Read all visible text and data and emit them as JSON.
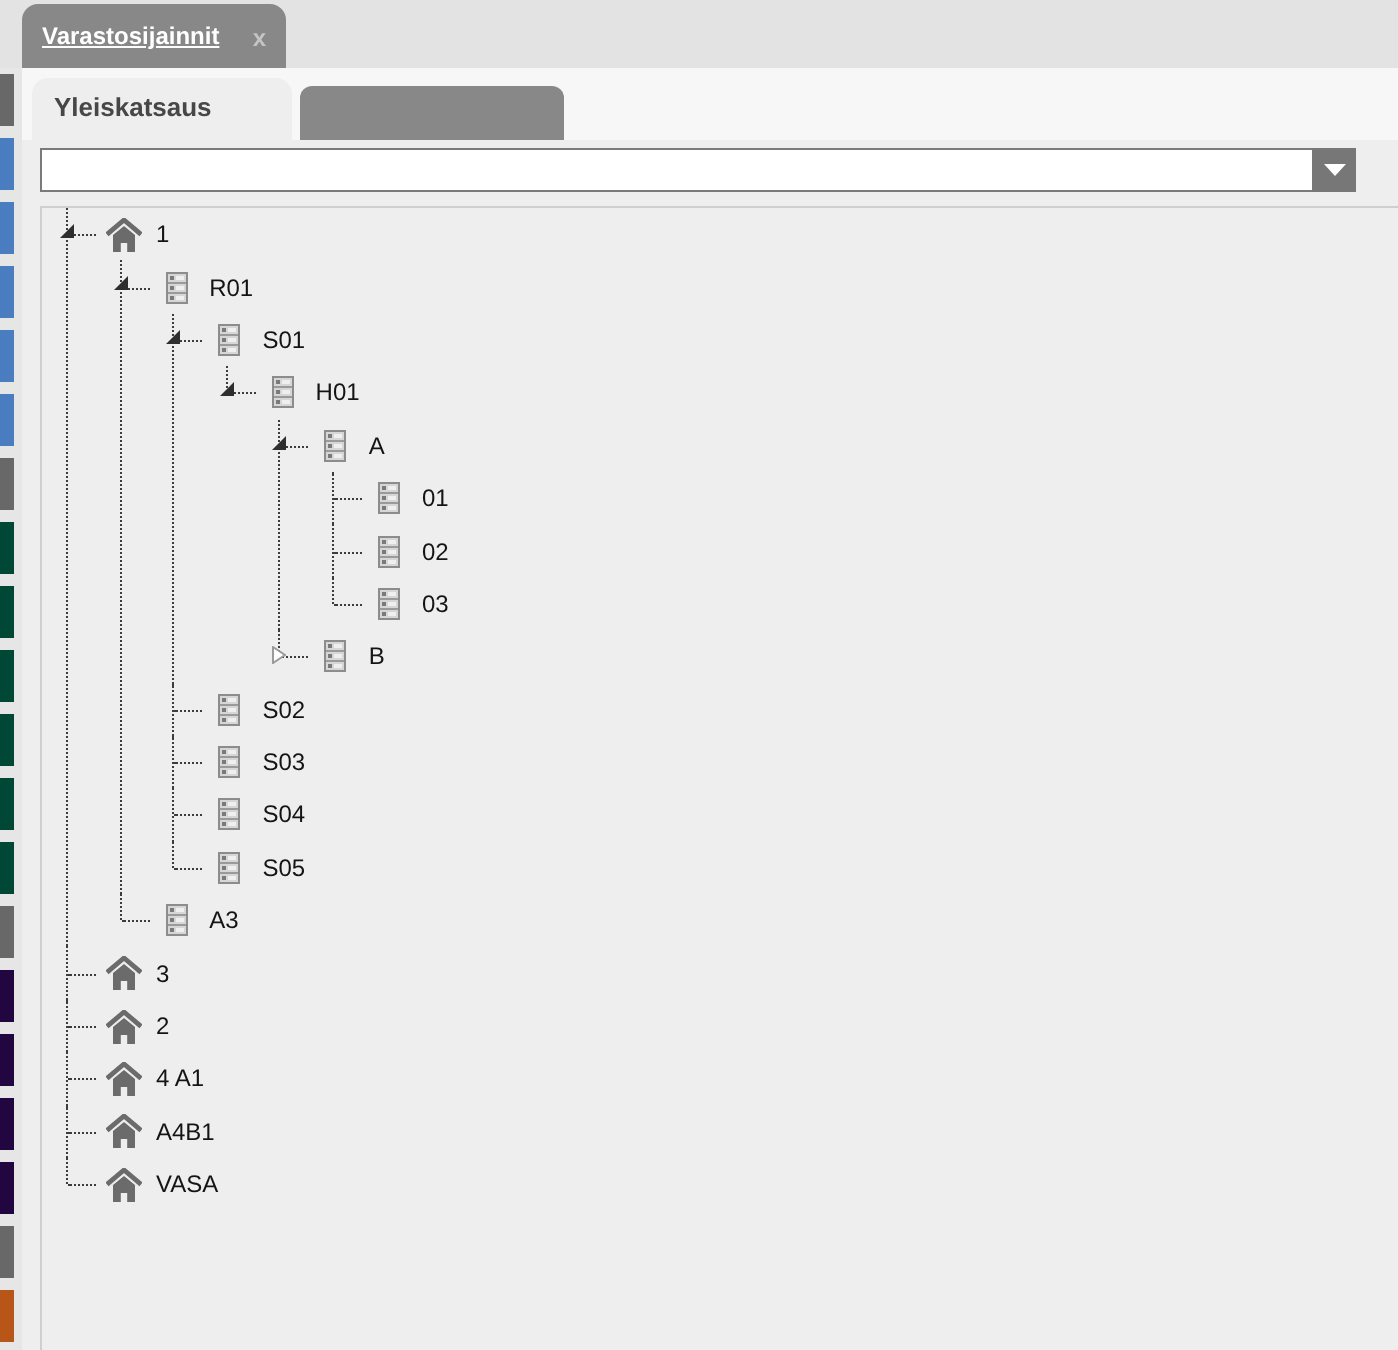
{
  "window": {
    "tab": "Varastosijainnit",
    "close": "x"
  },
  "sidebar": {
    "items": [
      {
        "color": "#686868"
      },
      {
        "color": "#4a7cc0"
      },
      {
        "color": "#4a7cc0"
      },
      {
        "color": "#4a7cc0"
      },
      {
        "color": "#4a7cc0"
      },
      {
        "color": "#4a7cc0"
      },
      {
        "color": "#686868"
      },
      {
        "color": "#004736"
      },
      {
        "color": "#004736"
      },
      {
        "color": "#004736"
      },
      {
        "color": "#004736"
      },
      {
        "color": "#004736"
      },
      {
        "color": "#004736"
      },
      {
        "color": "#686868"
      },
      {
        "color": "#210640"
      },
      {
        "color": "#210640"
      },
      {
        "color": "#210640"
      },
      {
        "color": "#210640"
      },
      {
        "color": "#686868"
      },
      {
        "color": "#b8561a"
      }
    ]
  },
  "tabs": [
    {
      "label": "Yleiskatsaus",
      "selected": true
    },
    {
      "selected": false
    }
  ],
  "tree": {
    "nodes": [
      {
        "label": "1",
        "expanded": true,
        "children": [
          {
            "label": "R01",
            "expanded": true,
            "children": [
              {
                "label": "S01",
                "expanded": true,
                "children": [
                  {
                    "label": "H01",
                    "expanded": true,
                    "children": [
                      {
                        "label": "A",
                        "expanded": true,
                        "children": [
                          {
                            "label": "01"
                          },
                          {
                            "label": "02"
                          },
                          {
                            "label": "03"
                          }
                        ]
                      },
                      {
                        "label": "B",
                        "expanded": false
                      }
                    ]
                  }
                ]
              },
              {
                "label": "S02"
              },
              {
                "label": "S03"
              },
              {
                "label": "S04"
              },
              {
                "label": "S05"
              }
            ]
          },
          {
            "label": "A3"
          }
        ]
      },
      {
        "label": "3"
      },
      {
        "label": "2"
      },
      {
        "label": "4 A1"
      },
      {
        "label": "A4B1"
      },
      {
        "label": "VASA"
      }
    ]
  }
}
